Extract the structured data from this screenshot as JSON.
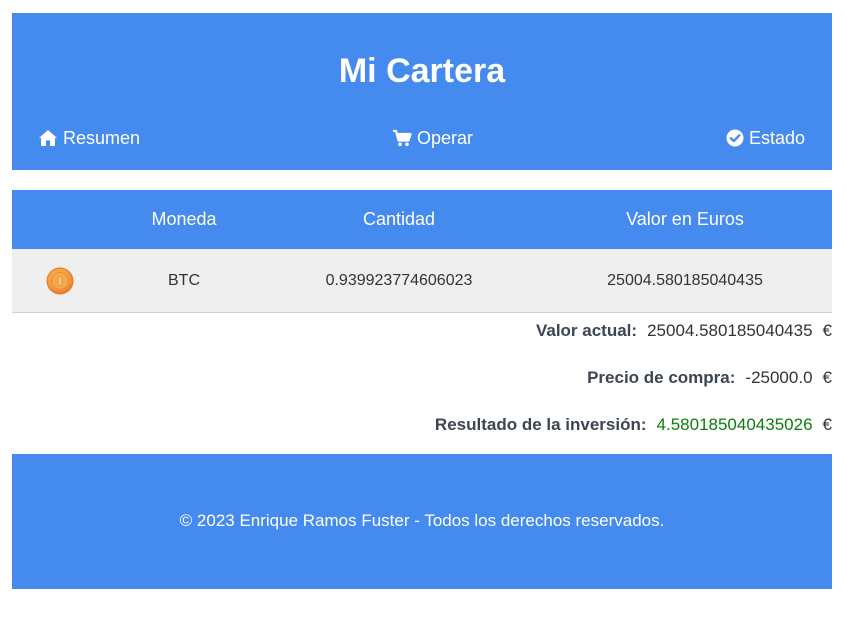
{
  "header": {
    "title": "Mi Cartera",
    "nav": [
      {
        "label": "Resumen",
        "icon": "home-icon"
      },
      {
        "label": "Operar",
        "icon": "cart-icon"
      },
      {
        "label": "Estado",
        "icon": "check-circle-icon"
      }
    ]
  },
  "table": {
    "headers": [
      "",
      "Moneda",
      "Cantidad",
      "Valor en Euros"
    ],
    "rows": [
      {
        "icon": "bitcoin-coin-icon",
        "coin": "BTC",
        "quantity": "0.939923774606023",
        "value_eur": "25004.580185040435"
      }
    ]
  },
  "summary": {
    "current_value_label": "Valor actual:",
    "current_value": "25004.580185040435",
    "purchase_price_label": "Precio de compra:",
    "purchase_price": "-25000.0",
    "result_label": "Resultado de la inversión:",
    "result": "4.580185040435026",
    "currency": "€"
  },
  "footer": {
    "text": "© 2023 Enrique Ramos Fuster - Todos los derechos reservados."
  },
  "colors": {
    "brand": "#448aef",
    "row_background": "#efefef",
    "positive": "#0b7d0b"
  }
}
